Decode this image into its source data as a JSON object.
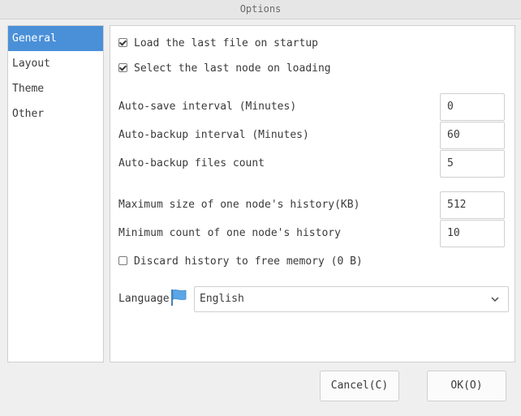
{
  "window": {
    "title": "Options"
  },
  "sidebar": {
    "items": [
      {
        "label": "General",
        "active": true
      },
      {
        "label": "Layout",
        "active": false
      },
      {
        "label": "Theme",
        "active": false
      },
      {
        "label": "Other",
        "active": false
      }
    ]
  },
  "general": {
    "load_last_file": {
      "label": "Load the last file on startup",
      "checked": true
    },
    "select_last_node": {
      "label": "Select the last node on loading",
      "checked": true
    },
    "autosave_interval": {
      "label": "Auto-save interval (Minutes)",
      "value": "0"
    },
    "autobackup_interval": {
      "label": "Auto-backup interval (Minutes)",
      "value": "60"
    },
    "autobackup_count": {
      "label": "Auto-backup files count",
      "value": "5"
    },
    "max_history_size": {
      "label": "Maximum size of one node's history(KB)",
      "value": "512"
    },
    "min_history_count": {
      "label": "Minimum count of one node's history",
      "value": "10"
    },
    "discard_history": {
      "label": "Discard history to free memory (0 B)",
      "checked": false
    },
    "language": {
      "label": "Language",
      "value": "English",
      "icon": "flag-icon"
    }
  },
  "buttons": {
    "cancel": "Cancel(C)",
    "ok": "OK(O)"
  },
  "colors": {
    "accent": "#4a90d9",
    "flag": "#5aa6e6"
  }
}
